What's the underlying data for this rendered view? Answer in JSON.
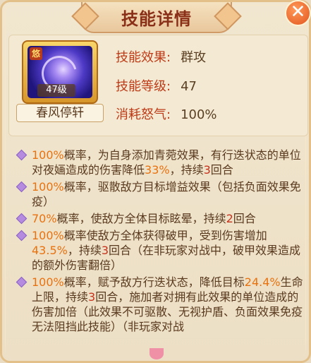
{
  "window": {
    "title": "技能详情",
    "close_label": "✕"
  },
  "skill": {
    "icon_tag": "悠",
    "level_badge": "47级",
    "name": "春风停轩",
    "effect_label": "技能效果:",
    "effect_value": "群攻",
    "level_label": "技能等级:",
    "level_value": "47",
    "rage_label": "消耗怒气:",
    "rage_value": "100%"
  },
  "description": [
    {
      "parts": [
        {
          "t": "100%",
          "c": "o"
        },
        {
          "t": "概率，为自身添加青菀效果，有行迭状态的单位对夜婳造成的伤害降低"
        },
        {
          "t": "33%",
          "c": "o"
        },
        {
          "t": "，持续"
        },
        {
          "t": "3",
          "c": "r"
        },
        {
          "t": "回合"
        }
      ]
    },
    {
      "parts": [
        {
          "t": "100%",
          "c": "o"
        },
        {
          "t": "概率，驱散敌方目标增益效果（包括负面效果免疫）"
        }
      ]
    },
    {
      "parts": [
        {
          "t": "70%",
          "c": "o"
        },
        {
          "t": "概率，使敌方全体目标眩晕，持续"
        },
        {
          "t": "2",
          "c": "r"
        },
        {
          "t": "回合"
        }
      ]
    },
    {
      "parts": [
        {
          "t": "100%",
          "c": "o"
        },
        {
          "t": "概率使敌方全体获得破甲，受到伤害增加"
        },
        {
          "t": "43.5%",
          "c": "o"
        },
        {
          "t": "，持续"
        },
        {
          "t": "3",
          "c": "r"
        },
        {
          "t": "回合（在非玩家对战中，破甲效果造成的额外伤害翻倍）"
        }
      ]
    },
    {
      "parts": [
        {
          "t": "100%",
          "c": "o"
        },
        {
          "t": "概率，赋予敌方行迭状态，降低目标"
        },
        {
          "t": "24.4%",
          "c": "o"
        },
        {
          "t": "生命上限，持续"
        },
        {
          "t": "3",
          "c": "r"
        },
        {
          "t": "回合，施加者对拥有此效果的单位造成的伤害加倍（此效果不可驱散、无视护盾、负面效果免疫无法阻挡此技能）（非玩家对战"
        }
      ]
    }
  ],
  "colors": {
    "accent_orange": "#e8720f",
    "accent_red": "#c7321c",
    "label_red": "#bd3a16"
  }
}
